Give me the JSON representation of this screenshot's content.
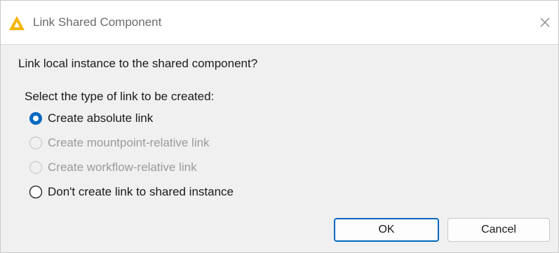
{
  "window": {
    "title": "Link Shared Component",
    "icon": "warning-triangle-icon",
    "close_icon": "close-icon"
  },
  "message": "Link local instance to the shared component?",
  "link_options": {
    "label": "Select the type of link to be created:",
    "selected": "Create absolute link",
    "options": [
      {
        "label": "Create absolute link",
        "selected": true,
        "enabled": true
      },
      {
        "label": "Create mountpoint-relative link",
        "selected": false,
        "enabled": false
      },
      {
        "label": "Create workflow-relative link",
        "selected": false,
        "enabled": false
      },
      {
        "label": "Don't create link to shared instance",
        "selected": false,
        "enabled": true
      }
    ]
  },
  "buttons": {
    "ok": "OK",
    "cancel": "Cancel"
  },
  "colors": {
    "accent": "#0067c0",
    "warning_icon": "#f5b400",
    "disabled_text": "#9a9a9a"
  }
}
